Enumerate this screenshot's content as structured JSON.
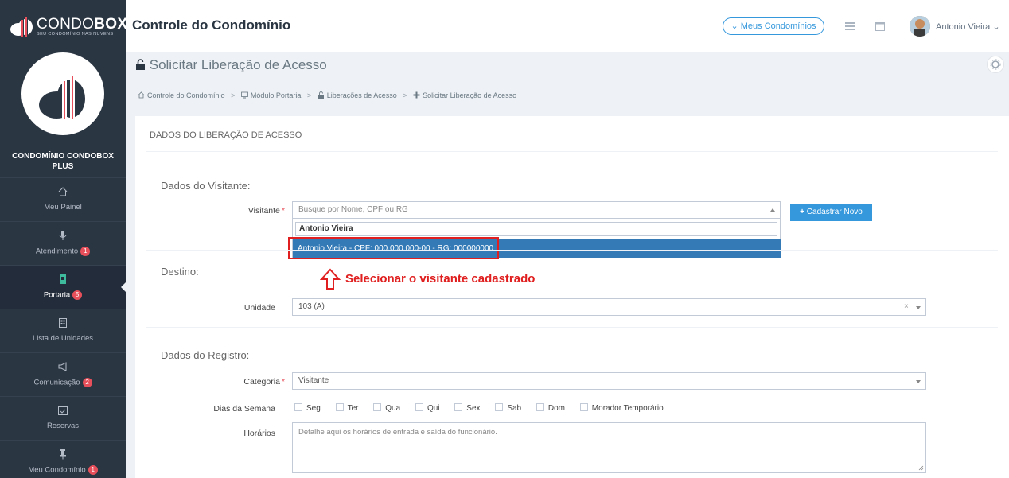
{
  "brand": {
    "name_light": "CONDO",
    "name_bold": "BOX",
    "tagline": "SEU CONDOMÍNIO NAS NUVENS"
  },
  "header": {
    "title": "Controle do Condomínio",
    "condos_button": "Meus Condomínios",
    "user_name": "Antonio Vieira"
  },
  "sidebar": {
    "condo_name_line1": "CONDOMÍNIO CONDOBOX",
    "condo_name_line2": "PLUS",
    "items": [
      {
        "label": "Meu Painel",
        "icon": "home-icon",
        "badge": ""
      },
      {
        "label": "Atendimento",
        "icon": "microphone-icon",
        "badge": "1"
      },
      {
        "label": "Portaria",
        "icon": "badge-icon",
        "badge": "5",
        "active": true
      },
      {
        "label": "Lista de Unidades",
        "icon": "building-icon",
        "badge": ""
      },
      {
        "label": "Comunicação",
        "icon": "megaphone-icon",
        "badge": "2"
      },
      {
        "label": "Reservas",
        "icon": "calendar-check-icon",
        "badge": ""
      },
      {
        "label": "Meu Condomínio",
        "icon": "pin-icon",
        "badge": "1"
      }
    ]
  },
  "page": {
    "title": "Solicitar Liberação de Acesso",
    "breadcrumb": [
      {
        "label": "Controle do Condomínio",
        "icon": "home-icon"
      },
      {
        "label": "Módulo Portaria",
        "icon": "monitor-icon"
      },
      {
        "label": "Liberações de Acesso",
        "icon": "unlock-icon"
      },
      {
        "label": "Solicitar Liberação de Acesso",
        "icon": "plus-icon"
      }
    ]
  },
  "form": {
    "panel_title": "DADOS DO LIBERAÇÃO DE ACESSO",
    "visitor_section": "Dados do Visitante:",
    "visitor_label": "Visitante",
    "visitor_placeholder": "Busque por Nome, CPF ou RG",
    "visitor_search_value": "Antonio Vieira",
    "visitor_option": "Antonio Vieira - CPF: 000.000.000-00 - RG: 000000000",
    "new_button": "Cadastrar Novo",
    "destination_section": "Destino:",
    "unit_label": "Unidade",
    "unit_value": "103 (A)",
    "record_section": "Dados do Registro:",
    "category_label": "Categoria",
    "category_value": "Visitante",
    "weekdays_label": "Dias da Semana",
    "weekdays": [
      "Seg",
      "Ter",
      "Qua",
      "Qui",
      "Sex",
      "Sab",
      "Dom",
      "Morador Temporário"
    ],
    "hours_label": "Horários",
    "hours_placeholder": "Detalhe aqui os horários de entrada e saída do funcionário.",
    "required_mark": "*"
  },
  "annotation": {
    "text": "Selecionar o visitante cadastrado",
    "color": "#e02020"
  },
  "colors": {
    "sidebar": "#2b3643",
    "primary": "#3598dc",
    "selected_option": "#337ab7",
    "badge": "#e7505a"
  }
}
